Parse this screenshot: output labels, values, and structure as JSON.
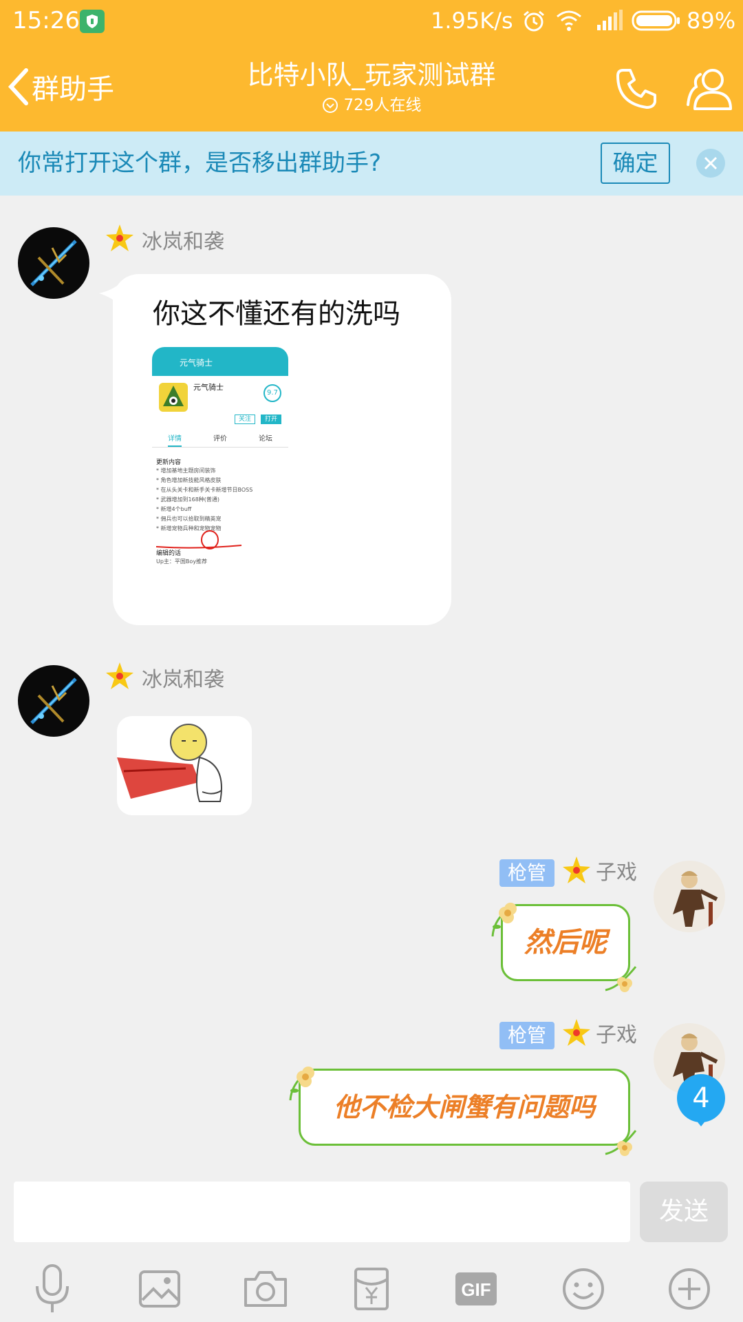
{
  "status_bar": {
    "time": "15:26",
    "net_speed": "1.95K/s",
    "battery": "89%",
    "icons": [
      "shield-icon",
      "alarm-icon",
      "wifi-icon",
      "signal-icon",
      "battery-icon"
    ]
  },
  "header": {
    "back_label": "群助手",
    "title": "比特小队_玩家测试群",
    "online": "729人在线",
    "icons": [
      "back-chevron-icon",
      "online-icon",
      "phone-icon",
      "members-icon"
    ]
  },
  "banner": {
    "text": "你常打开这个群，是否移出群助手?",
    "confirm": "确定"
  },
  "messages": [
    {
      "sender": "冰岚和袭",
      "text": "你这不懂还有的洗吗",
      "screenshot": {
        "app_bar": "元气骑士",
        "app_name": "元气骑士",
        "score": "9.7",
        "follow": "关注",
        "open": "打开",
        "tabs": [
          "详情",
          "评价",
          "论坛"
        ],
        "heading": "更新内容",
        "lines": [
          "* 增加基地主题房间装饰",
          "* 角色增加新技能风格皮肤",
          "* 在从头关卡和新手关卡新增节日BOSS",
          "* 武器增加到168种(普通)",
          "* 新增4个buff",
          "* 佣兵也可以拾取到精英宠",
          "* 新增宠物兵种和宠物宠物"
        ],
        "editor_heading": "编辑的话",
        "editor_line": "Up主：平国Boy推荐"
      }
    },
    {
      "sender": "冰岚和袭",
      "type": "sticker"
    },
    {
      "sender": "子戏",
      "tag": "枪管",
      "text": "然后呢"
    },
    {
      "sender": "子戏",
      "tag": "枪管",
      "text": "他不检大闸蟹有问题吗"
    }
  ],
  "unread_badge": "4",
  "composer": {
    "value": "",
    "send": "发送",
    "tools": [
      "microphone-icon",
      "image-icon",
      "camera-icon",
      "red-packet-icon",
      "gif-icon",
      "emoji-icon",
      "plus-icon"
    ],
    "gif_label": "GIF"
  },
  "colors": {
    "header": "#fdb92f",
    "banner": "#cdebf6",
    "banner_text": "#1a89b7",
    "tag": "#91bef5",
    "bubble_border": "#6bbf38",
    "bubble_text": "#ec7f27",
    "badge": "#24a8f2"
  }
}
